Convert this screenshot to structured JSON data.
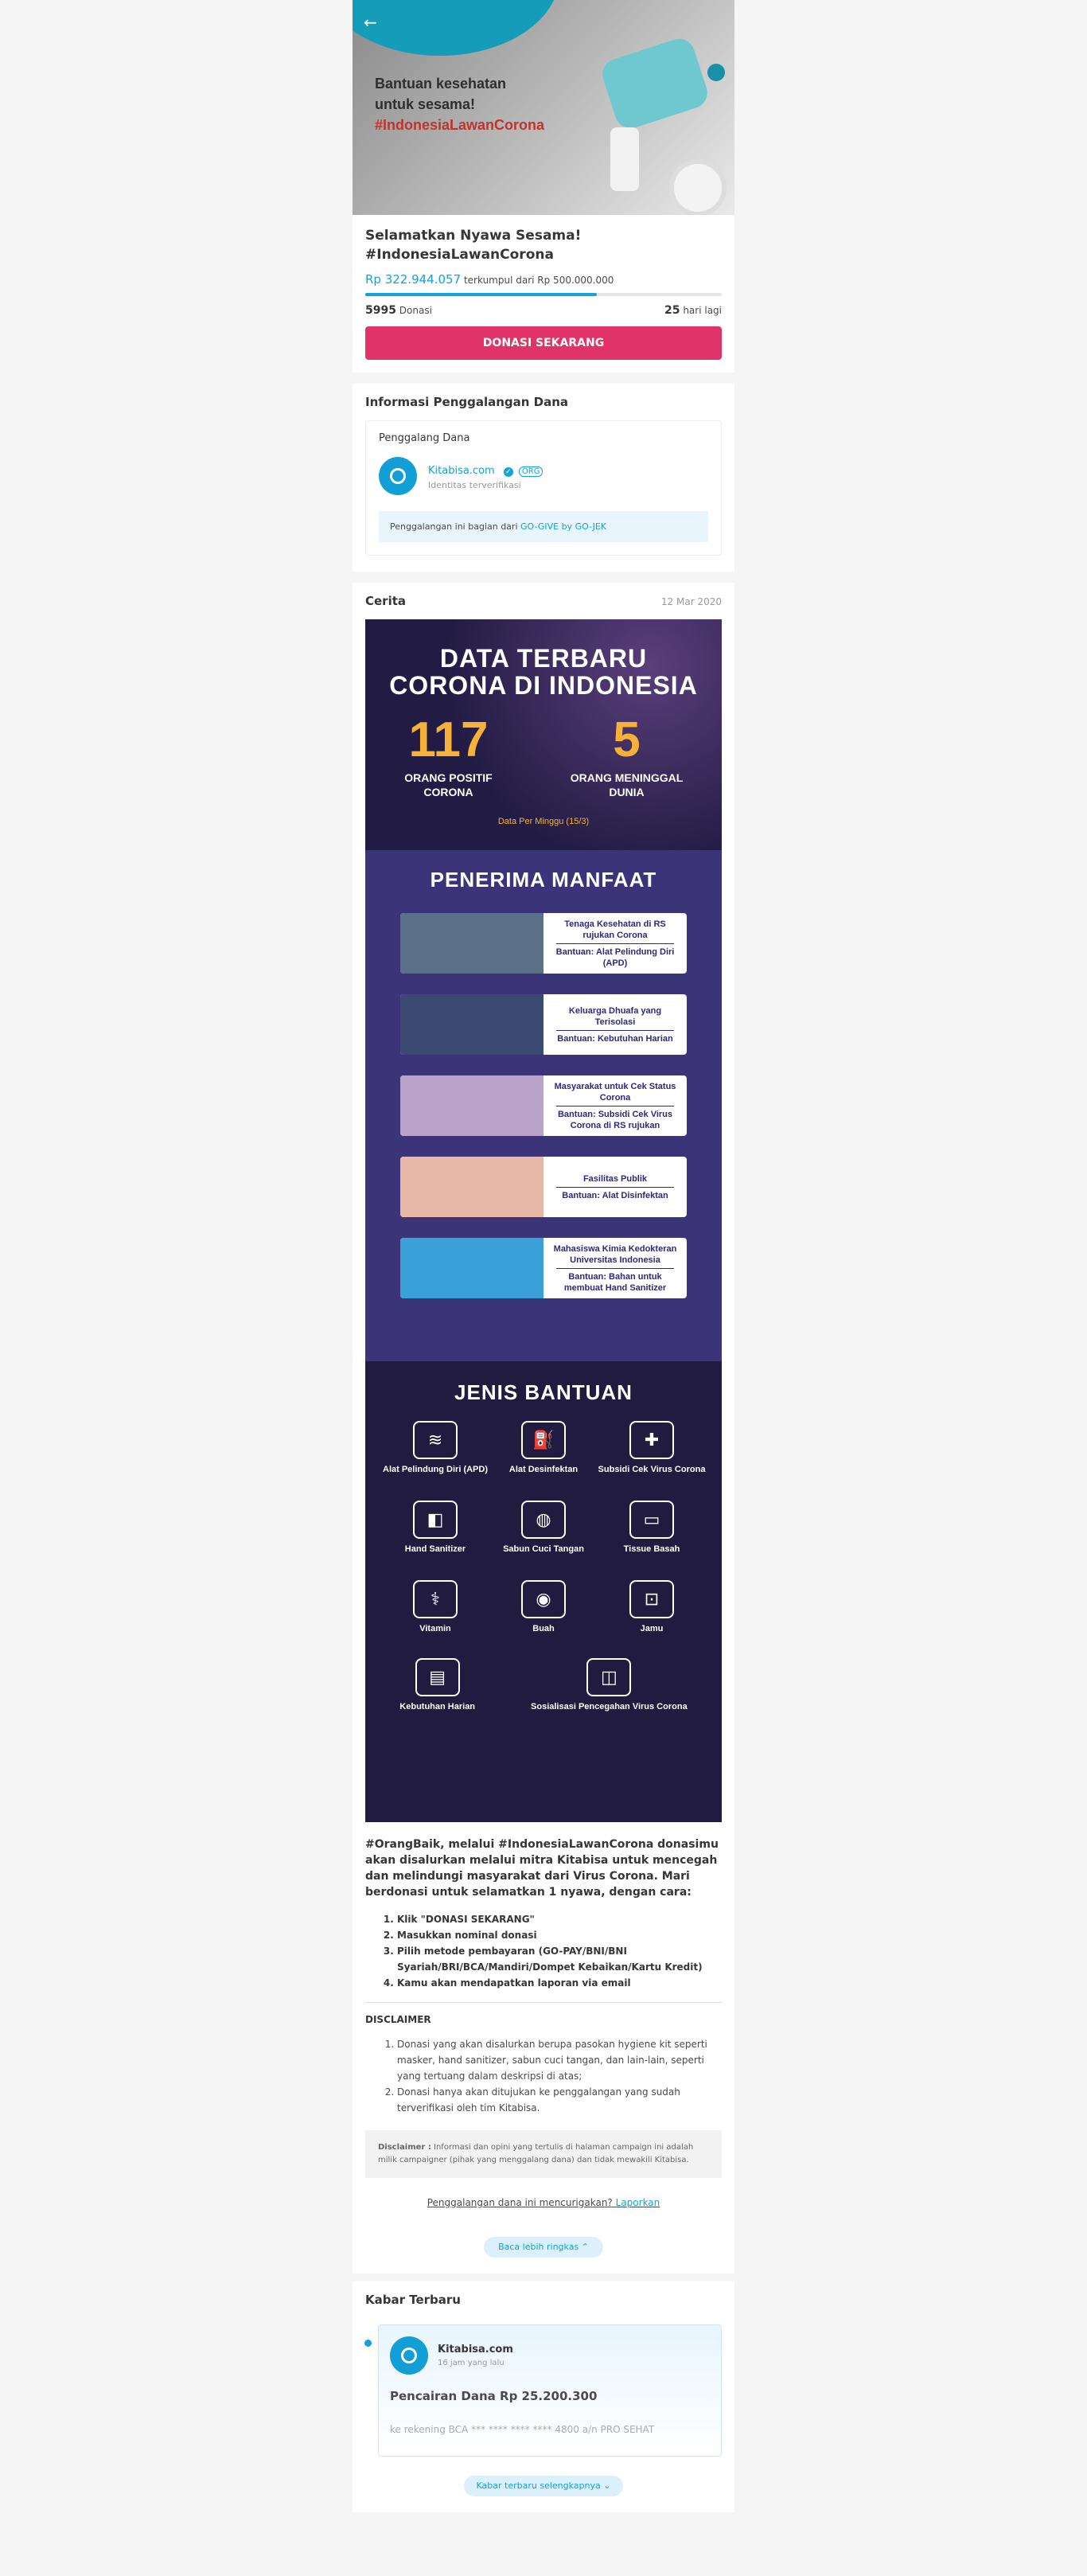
{
  "hero": {
    "line1": "Bantuan kesehatan",
    "line2": "untuk sesama!",
    "hashtag": "#IndonesiaLawanCorona"
  },
  "campaign": {
    "title": "Selamatkan Nyawa Sesama! #IndonesiaLawanCorona",
    "collected": "Rp 322.944.057",
    "target_text": "terkumpul dari Rp 500.000.000",
    "progress": 0.65,
    "donors": "5995",
    "donors_label": "Donasi",
    "days": "25",
    "days_label": "hari lagi",
    "donate_button": "DONASI SEKARANG"
  },
  "info": {
    "title": "Informasi Penggalangan Dana",
    "fundraiser_label": "Penggalang Dana",
    "org_name": "Kitabisa.com",
    "org_tag": "ORG",
    "org_status": "Identitas terverifikasi",
    "note_text": "Penggalangan ini bagian dari ",
    "note_link": "GO-GIVE by GO-JEK"
  },
  "story": {
    "title": "Cerita",
    "date": "12 Mar 2020",
    "infographic": {
      "title_line1": "DATA TERBARU",
      "title_line2": "CORONA DI INDONESIA",
      "positive_num": "117",
      "positive_label": "ORANG POSITIF CORONA",
      "death_num": "5",
      "death_label": "ORANG MENINGGAL DUNIA",
      "footnote": "Data Per Minggu (15/3)",
      "beneficiaries_title": "PENERIMA MANFAAT",
      "beneficiaries": [
        {
          "who": "Tenaga Kesehatan di RS rujukan Corona",
          "aid": "Bantuan: Alat Pelindung Diri (APD)",
          "color": "#5b6f86"
        },
        {
          "who": "Keluarga Dhuafa yang Terisolasi",
          "aid": "Bantuan: Kebutuhan Harian",
          "color": "#3c4a73"
        },
        {
          "who": "Masyarakat untuk Cek Status Corona",
          "aid": "Bantuan: Subsidi Cek Virus Corona di RS rujukan",
          "color": "#b9a3c8"
        },
        {
          "who": "Fasilitas Publik",
          "aid": "Bantuan: Alat Disinfektan",
          "color": "#e8b8a8"
        },
        {
          "who": "Mahasiswa Kimia Kedokteran Universitas Indonesia",
          "aid": "Bantuan: Bahan untuk membuat Hand Sanitizer",
          "color": "#3aa0d8"
        }
      ],
      "types_title": "JENIS BANTUAN",
      "types": [
        {
          "label": "Alat Pelindung Diri (APD)",
          "icon": "mask-icon",
          "glyph": "≋"
        },
        {
          "label": "Alat Desinfektan",
          "icon": "sprayer-icon",
          "glyph": "⛽"
        },
        {
          "label": "Subsidi Cek Virus Corona",
          "icon": "clipboard-icon",
          "glyph": "✚"
        },
        {
          "label": "Hand Sanitizer",
          "icon": "sanitizer-icon",
          "glyph": "◧"
        },
        {
          "label": "Sabun Cuci Tangan",
          "icon": "soap-icon",
          "glyph": "◍"
        },
        {
          "label": "Tissue Basah",
          "icon": "tissue-icon",
          "glyph": "▭"
        },
        {
          "label": "Vitamin",
          "icon": "vitamin-icon",
          "glyph": "⚕"
        },
        {
          "label": "Buah",
          "icon": "fruit-icon",
          "glyph": "◉"
        },
        {
          "label": "Jamu",
          "icon": "jar-icon",
          "glyph": "⊡"
        }
      ],
      "types_bottom": [
        {
          "label": "Kebutuhan Harian",
          "icon": "groceries-icon",
          "glyph": "▤"
        },
        {
          "label": "Sosialisasi Pencegahan Virus Corona",
          "icon": "meeting-icon",
          "glyph": "◫"
        }
      ]
    },
    "description": "#OrangBaik, melalui #IndonesiaLawanCorona donasimu akan disalurkan melalui mitra Kitabisa untuk mencegah dan melindungi masyarakat dari Virus Corona. Mari berdonasi untuk selamatkan 1 nyawa, dengan cara:",
    "steps": [
      "Klik \"DONASI SEKARANG\"",
      "Masukkan nominal donasi",
      "Pilih metode pembayaran (GO-PAY/BNI/BNI Syariah/BRI/BCA/Mandiri/Dompet Kebaikan/Kartu Kredit)",
      "Kamu akan mendapatkan laporan via email"
    ],
    "disclaimer_title": "DISCLAIMER",
    "disclaimers": [
      "Donasi yang akan disalurkan berupa pasokan hygiene kit seperti masker, hand sanitizer, sabun cuci tangan, dan lain-lain, seperti yang tertuang dalam deskripsi di atas;",
      "Donasi hanya akan ditujukan ke penggalangan yang sudah terverifikasi oleh tim Kitabisa."
    ],
    "disclaimer_box_label": "Disclaimer :",
    "disclaimer_box_text": "Informasi dan opini yang tertulis di halaman campaign ini adalah milik campaigner (pihak yang menggalang dana) dan tidak mewakili Kitabisa.",
    "report_text": "Penggalangan dana ini mencurigakan?",
    "report_link": "Laporkan",
    "collapse_button": "Baca lebih ringkas"
  },
  "news": {
    "title": "Kabar Terbaru",
    "org_name": "Kitabisa.com",
    "time": "16 jam yang lalu",
    "update_title": "Pencairan Dana Rp 25.200.300",
    "update_text": "ke rekening BCA *** **** **** **** 4800 a/n PRO SEHAT",
    "more_button": "Kabar terbaru selengkapnya"
  }
}
